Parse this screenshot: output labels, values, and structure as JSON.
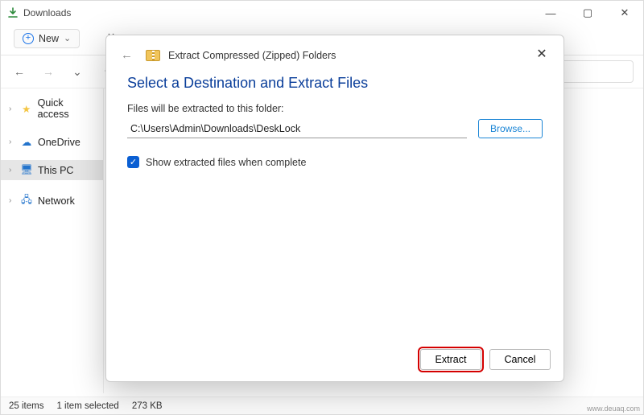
{
  "window": {
    "title": "Downloads",
    "controls": {
      "min": "—",
      "max": "▢",
      "close": "✕"
    }
  },
  "toolbar": {
    "new_label": "New",
    "new_chevron": "⌄"
  },
  "nav": {
    "back": "←",
    "forward": "→",
    "recent": "⌄",
    "up": "↑"
  },
  "sidebar": {
    "items": [
      {
        "label": "Quick access",
        "icon": "star",
        "chev": "›"
      },
      {
        "label": "OneDrive",
        "icon": "cloud",
        "chev": "›"
      },
      {
        "label": "This PC",
        "icon": "pc",
        "chev": "›",
        "selected": true
      },
      {
        "label": "Network",
        "icon": "net",
        "chev": "›"
      }
    ]
  },
  "statusbar": {
    "items_count": "25 items",
    "selection": "1 item selected",
    "size": "273 KB"
  },
  "dialog": {
    "close": "✕",
    "back": "←",
    "header": "Extract Compressed (Zipped) Folders",
    "title": "Select a Destination and Extract Files",
    "prompt": "Files will be extracted to this folder:",
    "path": "C:\\Users\\Admin\\Downloads\\DeskLock",
    "browse_label": "Browse...",
    "checkbox_label": "Show extracted files when complete",
    "checkbox_checked": true,
    "extract_label": "Extract",
    "cancel_label": "Cancel"
  },
  "watermark": "www.deuaq.com"
}
